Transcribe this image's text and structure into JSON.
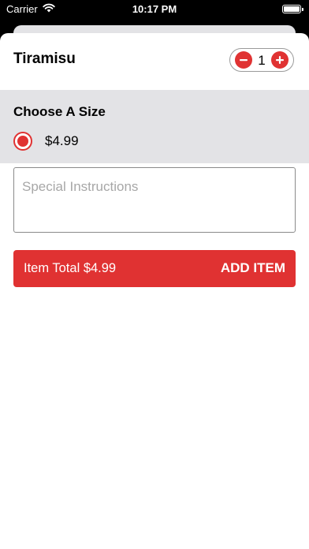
{
  "status_bar": {
    "carrier": "Carrier",
    "time": "10:17 PM"
  },
  "item": {
    "title": "Tiramisu",
    "quantity": "1"
  },
  "size_section": {
    "heading": "Choose A Size",
    "options": [
      {
        "price": "$4.99",
        "selected": true
      }
    ]
  },
  "instructions": {
    "placeholder": "Special Instructions",
    "value": ""
  },
  "footer": {
    "total_label": "Item Total $4.99",
    "add_label": "ADD ITEM"
  },
  "colors": {
    "accent": "#e03232",
    "section_bg": "#e3e3e6"
  },
  "icons": {
    "minus": "minus-circle-icon",
    "plus": "plus-circle-icon",
    "wifi": "wifi-icon",
    "battery": "battery-icon"
  }
}
